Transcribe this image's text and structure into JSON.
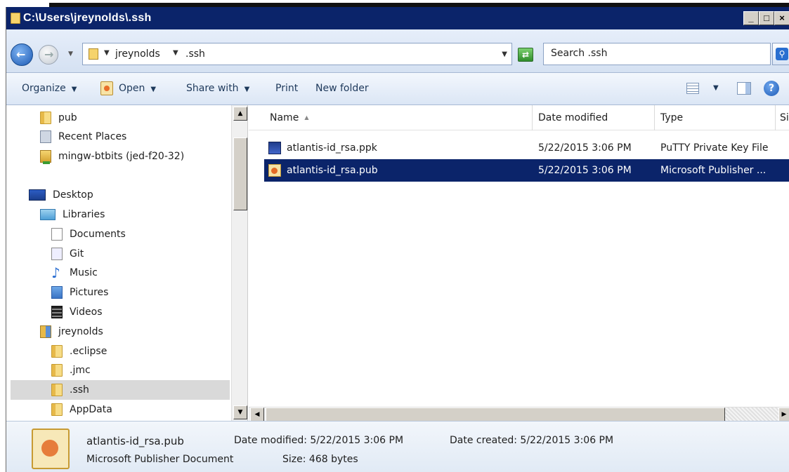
{
  "window": {
    "title": "C:\\Users\\jreynolds\\.ssh",
    "caption_buttons": [
      "_",
      "□",
      "×"
    ]
  },
  "address": {
    "crumbs": [
      "jreynolds",
      ".ssh"
    ],
    "search_placeholder": "Search .ssh"
  },
  "toolbar": {
    "organize": "Organize",
    "open": "Open",
    "share_with": "Share with",
    "print": "Print",
    "new_folder": "New folder"
  },
  "nav_tree": [
    {
      "label": "pub",
      "icon": "folder-icon"
    },
    {
      "label": "Recent Places",
      "icon": "recent-places-icon"
    },
    {
      "label": "mingw-btbits (jed-f20-32)",
      "icon": "mapped-folder-icon"
    },
    {
      "label": "Desktop",
      "icon": "desktop-icon"
    },
    {
      "label": "Libraries",
      "icon": "libraries-icon"
    },
    {
      "label": "Documents",
      "icon": "documents-icon"
    },
    {
      "label": "Git",
      "icon": "git-library-icon"
    },
    {
      "label": "Music",
      "icon": "music-icon"
    },
    {
      "label": "Pictures",
      "icon": "pictures-icon"
    },
    {
      "label": "Videos",
      "icon": "videos-icon"
    },
    {
      "label": "jreynolds",
      "icon": "user-folder-icon"
    },
    {
      "label": ".eclipse",
      "icon": "folder-icon"
    },
    {
      "label": ".jmc",
      "icon": "folder-icon"
    },
    {
      "label": ".ssh",
      "icon": "folder-icon",
      "selected": true
    },
    {
      "label": "AppData",
      "icon": "folder-icon"
    }
  ],
  "file_list": {
    "columns": [
      "Name",
      "Date modified",
      "Type",
      "Size"
    ],
    "rows": [
      {
        "name": "atlantis-id_rsa.ppk",
        "date": "5/22/2015 3:06 PM",
        "type": "PuTTY Private Key File",
        "icon": "putty-key-icon",
        "selected": false
      },
      {
        "name": "atlantis-id_rsa.pub",
        "date": "5/22/2015 3:06 PM",
        "type": "Microsoft Publisher ...",
        "icon": "publisher-file-icon",
        "selected": true
      }
    ]
  },
  "details": {
    "file_name": "atlantis-id_rsa.pub",
    "file_type": "Microsoft Publisher Document",
    "date_modified_label": "Date modified:",
    "date_modified": "5/22/2015 3:06 PM",
    "date_created_label": "Date created:",
    "date_created": "5/22/2015 3:06 PM",
    "size_label": "Size:",
    "size": "468 bytes"
  },
  "colors": {
    "titlebar": "#0b246a",
    "selection": "#0b246a",
    "tree_selection": "#d9d9d9"
  }
}
